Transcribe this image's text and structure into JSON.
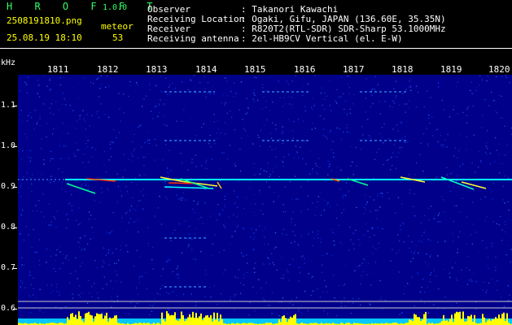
{
  "header": {
    "app_name": "H R O F F T",
    "version": "1.0.0",
    "filename": "2508191810.png",
    "datetime": "25.08.19 18:10",
    "meteor_label": "meteor",
    "meteor_count": "53",
    "info": [
      {
        "label": "Observer",
        "value": ": Takanori Kawachi"
      },
      {
        "label": "Receiving Location",
        "value": ": Ogaki, Gifu, JAPAN (136.60E, 35.35N)"
      },
      {
        "label": "Receiver",
        "value": ": R820T2(RTL-SDR) SDR-Sharp 53.1000MHz"
      },
      {
        "label": "Receiving antenna",
        "value": ": 2el-HB9CV Vertical (el. E-W)"
      }
    ]
  },
  "axes": {
    "y_unit": "kHz",
    "x_ticks": [
      "1811",
      "1812",
      "1813",
      "1814",
      "1815",
      "1816",
      "1817",
      "1818",
      "1819",
      "1820"
    ],
    "y_ticks": [
      "1.1",
      "1.0",
      "0.9",
      "0.8",
      "0.7",
      "0.6"
    ]
  },
  "colors": {
    "background": "#00008b",
    "carrier": "#00ffff",
    "meteor_echo": "#ff3300",
    "text": "#ffffff",
    "title": "#33ff66",
    "highlight": "#ffff00"
  }
}
